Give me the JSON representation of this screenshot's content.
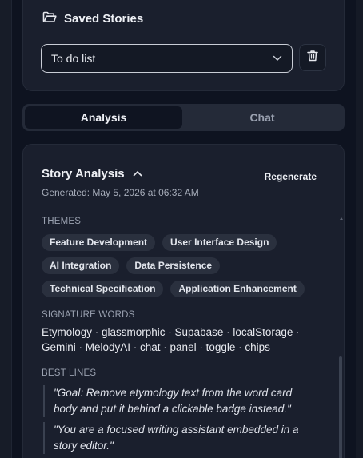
{
  "saved_stories": {
    "title": "Saved Stories",
    "icon": "folder-open-icon",
    "selected_story": "To do list"
  },
  "tabs": [
    {
      "label": "Analysis",
      "active": true
    },
    {
      "label": "Chat",
      "active": false
    }
  ],
  "analysis": {
    "title": "Story Analysis",
    "regenerate_label": "Regenerate",
    "generated_text": "Generated: May 5, 2026 at 06:32 AM",
    "themes_label": "THEMES",
    "themes": [
      "Feature Development",
      "User Interface Design",
      "AI Integration",
      "Data Persistence",
      "Technical Specification",
      "Application Enhancement"
    ],
    "signature_words_label": "SIGNATURE WORDS",
    "signature_words_line1": "Etymology · glassmorphic · Supabase · localStorage ·",
    "signature_words_line2": "Gemini · MelodyAI · chat · panel · toggle · chips",
    "best_lines_label": "BEST LINES",
    "best_lines": [
      "\"Goal: Remove etymology text from the word card body and put it behind a clickable badge instead.\"",
      "\"You are a focused writing assistant embedded in a story editor.\""
    ]
  },
  "colors": {
    "background": "#0e1320",
    "card": "#1a1f2d",
    "chip": "#2a303e"
  }
}
